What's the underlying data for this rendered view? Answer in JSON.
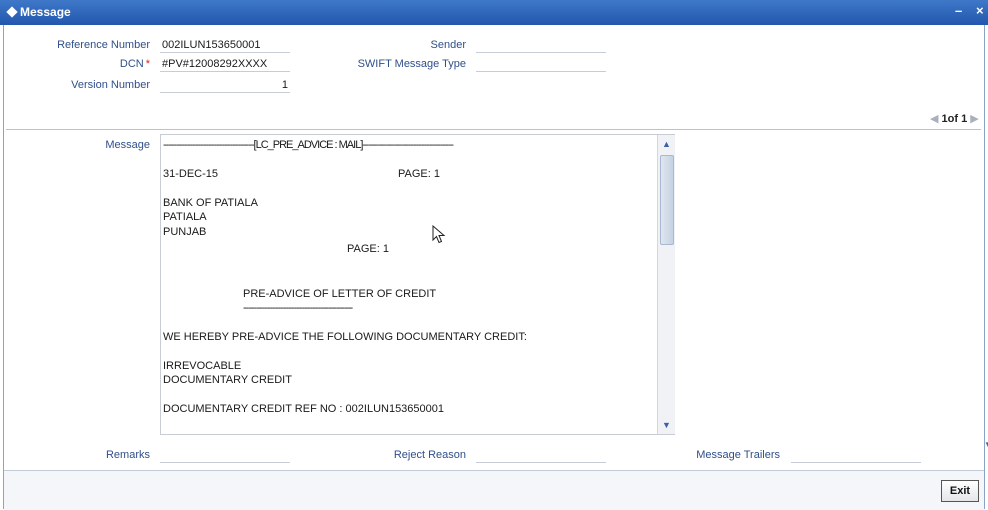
{
  "window": {
    "title": "Message",
    "minimize_glyph": "–",
    "close_glyph": "×"
  },
  "header": {
    "reference_number": {
      "label": "Reference Number",
      "value": "002ILUN153650001"
    },
    "dcn": {
      "label": "DCN",
      "required_marker": "*",
      "value": "#PV#12008292XXXX"
    },
    "version_number": {
      "label": "Version Number",
      "value": "1"
    },
    "sender": {
      "label": "Sender",
      "value": ""
    },
    "swift_message_type": {
      "label": "SWIFT Message Type",
      "value": ""
    }
  },
  "pager": {
    "text": "1of 1",
    "prev_icon": "chevron-left-icon",
    "next_icon": "chevron-right-icon"
  },
  "message": {
    "label": "Message",
    "lines": [
      "----------------------------------[LC_PRE_ADVICE : MAIL]----------------------------------",
      "31-DEC-15",
      "PAGE: 1",
      "BANK OF PATIALA",
      "PATIALA",
      "PUNJAB",
      "PAGE: 1",
      "PRE-ADVICE OF LETTER OF CREDIT",
      "-----------------------------------------",
      "WE HEREBY PRE-ADVICE THE FOLLOWING DOCUMENTARY CREDIT:",
      "IRREVOCABLE",
      "DOCUMENTARY CREDIT",
      "DOCUMENTARY CREDIT REF NO : 002ILUN153650001"
    ]
  },
  "bottom_fields": {
    "remarks": {
      "label": "Remarks",
      "value": ""
    },
    "reject_reason": {
      "label": "Reject Reason",
      "value": ""
    },
    "message_trailers": {
      "label": "Message Trailers",
      "value": ""
    }
  },
  "footer": {
    "exit_label": "Exit"
  },
  "colors": {
    "titlebar": "#2a62b8",
    "label": "#2f4f8a",
    "required": "#e02020"
  }
}
